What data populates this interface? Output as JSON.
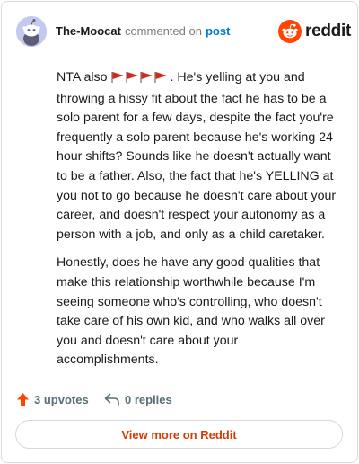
{
  "header": {
    "author": "The-Moocat",
    "commented": "commented on",
    "post_link": "post",
    "logo_text": "reddit"
  },
  "comment": {
    "para1_prefix": "NTA also",
    "para1_flag_count": 4,
    "para1_rest": ". He's yelling at you and throwing a hissy fit about the fact he has to be a solo parent for a few days, despite the fact you're frequently a solo parent because he's working 24 hour shifts? Sounds like he doesn't actually want to be a father. Also, the fact that he's YELLING at you not to go because he doesn't care about your career, and doesn't respect your autonomy as a person with a job, and only as a child caretaker.",
    "para2": "Honestly, does he have any good qualities that make this relationship worthwhile because I'm seeing someone who's controlling, who doesn't take care of his own kid, and who walks all over you and doesn't care about your accomplishments."
  },
  "actions": {
    "upvotes": "3 upvotes",
    "replies": "0 replies"
  },
  "view_more": "View more on Reddit",
  "colors": {
    "accent_orange": "#ff4500",
    "link_blue": "#0079d3",
    "view_more_text": "#d93a00",
    "flag_red": "#d42a1e"
  },
  "icons": {
    "avatar": "snoo-avatar-icon",
    "logo": "reddit-logo-icon",
    "flag": "red-flag-icon",
    "upvote": "upvote-arrow-icon",
    "reply": "reply-arrow-icon"
  }
}
